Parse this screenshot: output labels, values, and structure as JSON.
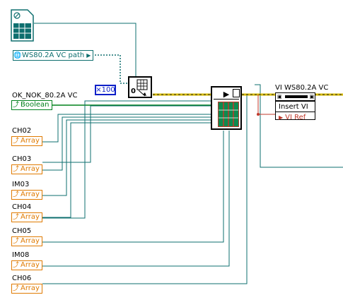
{
  "constants": {
    "vi_path": "WS80.2A VC path",
    "multiplier": "×100",
    "zero": "0"
  },
  "labels": {
    "ok_nok": "OK_NOK_80.2A VC",
    "ch02": "CH02",
    "ch03": "CH03",
    "im03": "IM03",
    "ch04": "CH04",
    "ch05": "CH05",
    "im08": "IM08",
    "ch06": "CH06",
    "vi_ref_name": "VI WS80.2A VC"
  },
  "terminals": {
    "boolean": "Boolean",
    "array": "Array"
  },
  "property_node": {
    "method": "Insert VI",
    "ref": "VI Ref"
  },
  "colors": {
    "orange_wire": "#e07a00",
    "green_wire": "#00801c",
    "teal_wire": "#0e6f6f",
    "refnum_wire": "#d4b800",
    "array_wire": "#0d8a4f"
  },
  "icons": [
    "file-constant-icon",
    "globe-path-icon",
    "build-array-icon",
    "call-by-reference-icon",
    "cluster-array-icon",
    "reference-icon"
  ]
}
